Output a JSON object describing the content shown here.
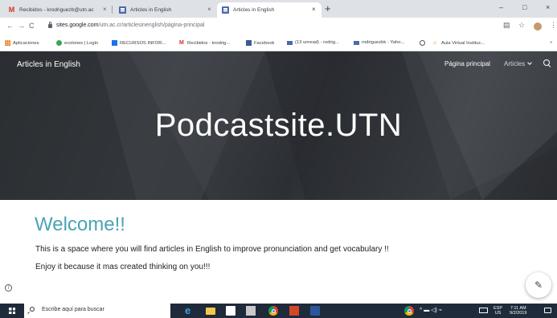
{
  "browser": {
    "tabs": [
      {
        "title": "Recibidos - krodriguezb@utn.ac",
        "icon": "gmail-icon",
        "active": false
      },
      {
        "title": "Articles in English",
        "icon": "google-sites-icon",
        "active": false
      },
      {
        "title": "Articles in English",
        "icon": "google-sites-icon",
        "active": true
      }
    ],
    "new_tab_symbol": "+",
    "close_symbol": "×",
    "window_controls": {
      "minimize": "–",
      "maximize": "□",
      "close": "×"
    },
    "url_host": "sites.google.com",
    "url_path": "/utn.ac.cr/articlesinenglish/página-principal",
    "nav": {
      "back": "←",
      "forward": "→",
      "reload": "C"
    },
    "toolbar_icons": {
      "translate": "▤",
      "star": "☆",
      "menu": "⋮"
    },
    "bookmarks": [
      {
        "label": "Aplicaciones",
        "icon": "apps-grid-icon"
      },
      {
        "label": "ecolones | Login",
        "icon": "ecolones-icon"
      },
      {
        "label": "RECURSOS INFOR...",
        "icon": "bookmark-blue-icon"
      },
      {
        "label": "Recibidos - krodrig...",
        "icon": "gmail-icon"
      },
      {
        "label": "Facebook",
        "icon": "facebook-icon"
      },
      {
        "label": "(13 unread) - rodrig...",
        "icon": "mail-icon"
      },
      {
        "label": "rodriguezbk - Yaho...",
        "icon": "mail-icon"
      },
      {
        "label": "",
        "icon": "globe-icon"
      },
      {
        "label": "Aula Virtual Instituc...",
        "icon": "aula-icon"
      }
    ],
    "bookmarks_overflow": "»"
  },
  "site": {
    "title": "Articles in English",
    "nav_home": "Página principal",
    "nav_articles": "Articles",
    "hero_heading": "Podcastsite.UTN"
  },
  "content": {
    "welcome": "Welcome!!",
    "line1": "This is a space where you will find articles in English to improve pronunciation and get vocabulary !!",
    "line2": "Enjoy it because it mas created thinking on you!!!"
  },
  "page_icons": {
    "info": "i",
    "edit": "✎"
  },
  "taskbar": {
    "search_placeholder": "Escribe aquí para buscar",
    "language_top": "ESP",
    "language_bottom": "US",
    "time": "7:11 AM",
    "date": "9/2/2019",
    "tray_symbols": "^ ▬ ◁) ⌁"
  },
  "colors": {
    "welcome_accent": "#4aa3b3",
    "hero_background": "#35383c",
    "taskbar": "#1f2a3a",
    "tab_strip": "#dee1e6"
  }
}
